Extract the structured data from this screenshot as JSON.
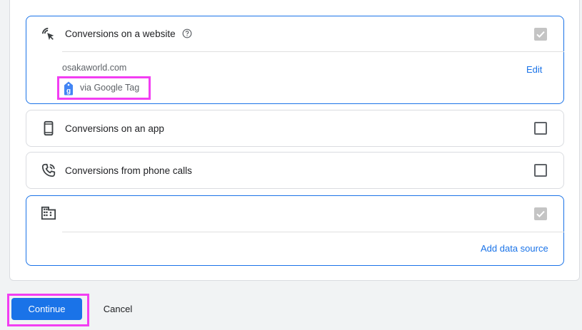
{
  "cards": {
    "website": {
      "title": "Conversions on a website",
      "checked": true,
      "domain": "osakaworld.com",
      "tag_label": "via Google Tag",
      "edit_label": "Edit",
      "icon": "cursor-click-icon"
    },
    "app": {
      "title": "Conversions on an app",
      "checked": false,
      "icon": "smartphone-icon"
    },
    "phone": {
      "title": "Conversions from phone calls",
      "checked": false,
      "icon": "phone-call-icon"
    },
    "offline": {
      "checked": true,
      "add_source_label": "Add data source",
      "icon": "building-icon"
    }
  },
  "footer": {
    "continue_label": "Continue",
    "cancel_label": "Cancel"
  },
  "colors": {
    "accent": "#1a73e8",
    "highlight": "#f23ef2",
    "checkbox_checked": "#c4c4c4"
  }
}
